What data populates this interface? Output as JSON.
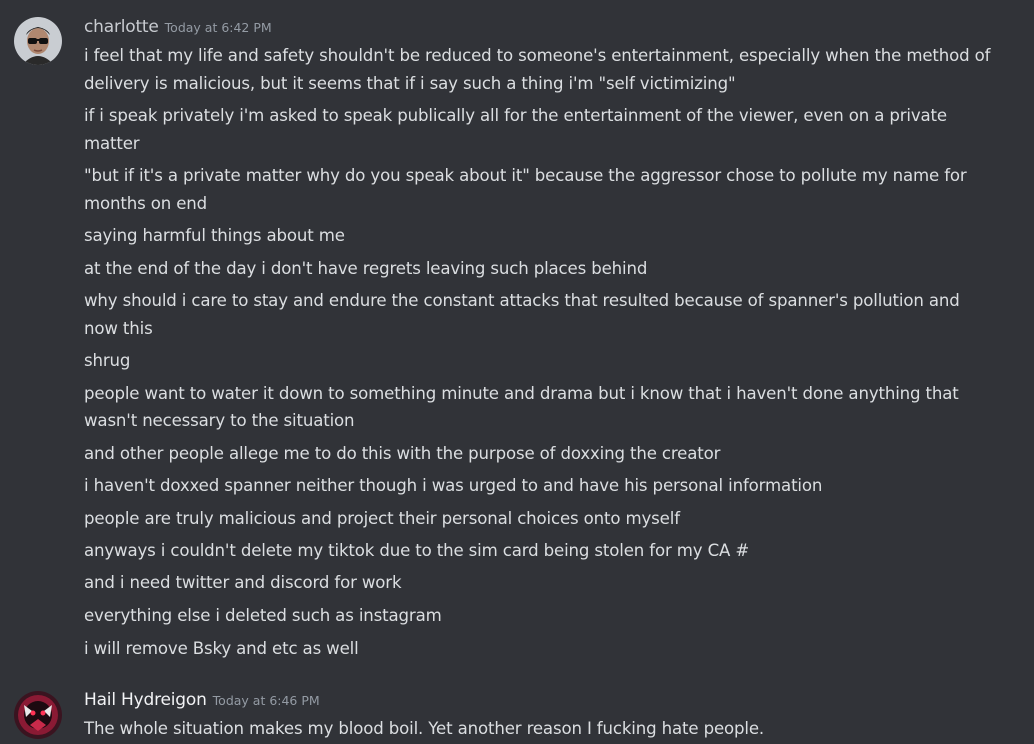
{
  "messages": [
    {
      "author": "charlotte",
      "timestamp": "Today at 6:42 PM",
      "lines": [
        "i feel that my life and safety shouldn't be reduced to someone's entertainment, especially when the method of",
        "delivery is malicious, but it seems that if i say such a thing i'm \"self victimizing\"",
        "if i speak privately i'm asked to speak publically all for the entertainment of the viewer, even on a private",
        "matter",
        "\"but if it's a private matter why do you speak about it\" because the aggressor chose to pollute my name for",
        "months on end",
        "saying harmful things about me",
        "at the end of the day i don't have regrets leaving such places behind",
        "why should i care to stay and endure the constant attacks that resulted because of spanner's pollution and",
        "now this",
        "shrug",
        "people want to water it down to something minute and drama but i know that i haven't done anything that",
        "wasn't necessary to the situation",
        "and other people allege me to do this with the purpose of doxxing the creator",
        "i haven't doxxed spanner neither though i was urged to and have his personal information",
        "people are truly malicious and project their personal choices onto myself",
        "anyways i couldn't delete my tiktok due to the sim card being stolen for my CA #",
        "and i need twitter and discord for work",
        "everything else i deleted such as instagram",
        "i will remove Bsky and etc as well"
      ]
    },
    {
      "author": "Hail Hydreigon",
      "timestamp": "Today at 6:46 PM",
      "lines": [
        "The whole situation makes my blood boil. Yet another reason I fucking hate people."
      ]
    }
  ],
  "colors": {
    "background": "#313338",
    "text": "#dbdee1",
    "username": "#f2f3f5",
    "timestamp": "#949ba4"
  }
}
